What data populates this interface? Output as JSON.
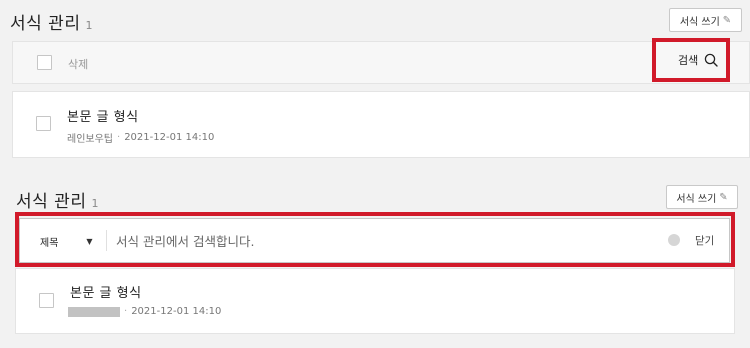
{
  "panel1": {
    "title": "서식 관리",
    "count": "1",
    "write_button": "서식 쓰기",
    "delete_label": "삭제",
    "search_label": "검색",
    "post": {
      "title": "본문 글 형식",
      "author": "레인보우팁",
      "separator": "·",
      "date": "2021-12-01 14:10"
    }
  },
  "panel2": {
    "title": "서식 관리",
    "count": "1",
    "write_button": "서식 쓰기",
    "select_value": "제목",
    "search_placeholder": "서식 관리에서 검색합니다.",
    "close_label": "닫기",
    "post": {
      "title": "본문 글 형식",
      "separator": "·",
      "date": "2021-12-01 14:10"
    }
  },
  "icons": {
    "pencil": "pencil-icon",
    "search": "magnifier-icon",
    "caret": "caret-down-icon"
  },
  "colors": {
    "highlight": "#d11a2a",
    "toolbar_bg": "#f7f7f7",
    "page_bg": "#f2f2f2"
  }
}
